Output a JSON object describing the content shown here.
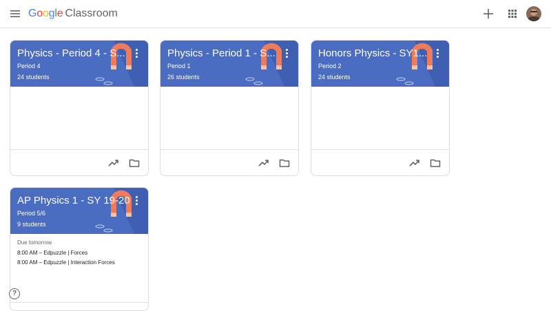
{
  "header": {
    "logo_google": "Google",
    "logo_product": "Classroom",
    "logo_colors": [
      "#4285F4",
      "#EA4335",
      "#FBBC05",
      "#4285F4",
      "#34A853",
      "#EA4335"
    ]
  },
  "colors": {
    "card_header": "#4a6cc1",
    "magnet": "#ef7b5a"
  },
  "classes": [
    {
      "title": "Physics - Period 4 - S...",
      "section": "Period 4",
      "students": "24 students"
    },
    {
      "title": "Physics - Period 1 - S...",
      "section": "Period 1",
      "students": "26 students"
    },
    {
      "title": "Honors Physics - SY1...",
      "section": "Period 2",
      "students": "24 students"
    },
    {
      "title": "AP Physics 1 - SY 19-20",
      "section": "Period 5/6",
      "students": "9 students",
      "due": {
        "heading": "Due tomorrow",
        "items": [
          "8:00 AM – Edpuzzle | Forces",
          "8:00 AM – Edpuzzle | Interaction Forces"
        ]
      }
    }
  ],
  "help_label": "?"
}
